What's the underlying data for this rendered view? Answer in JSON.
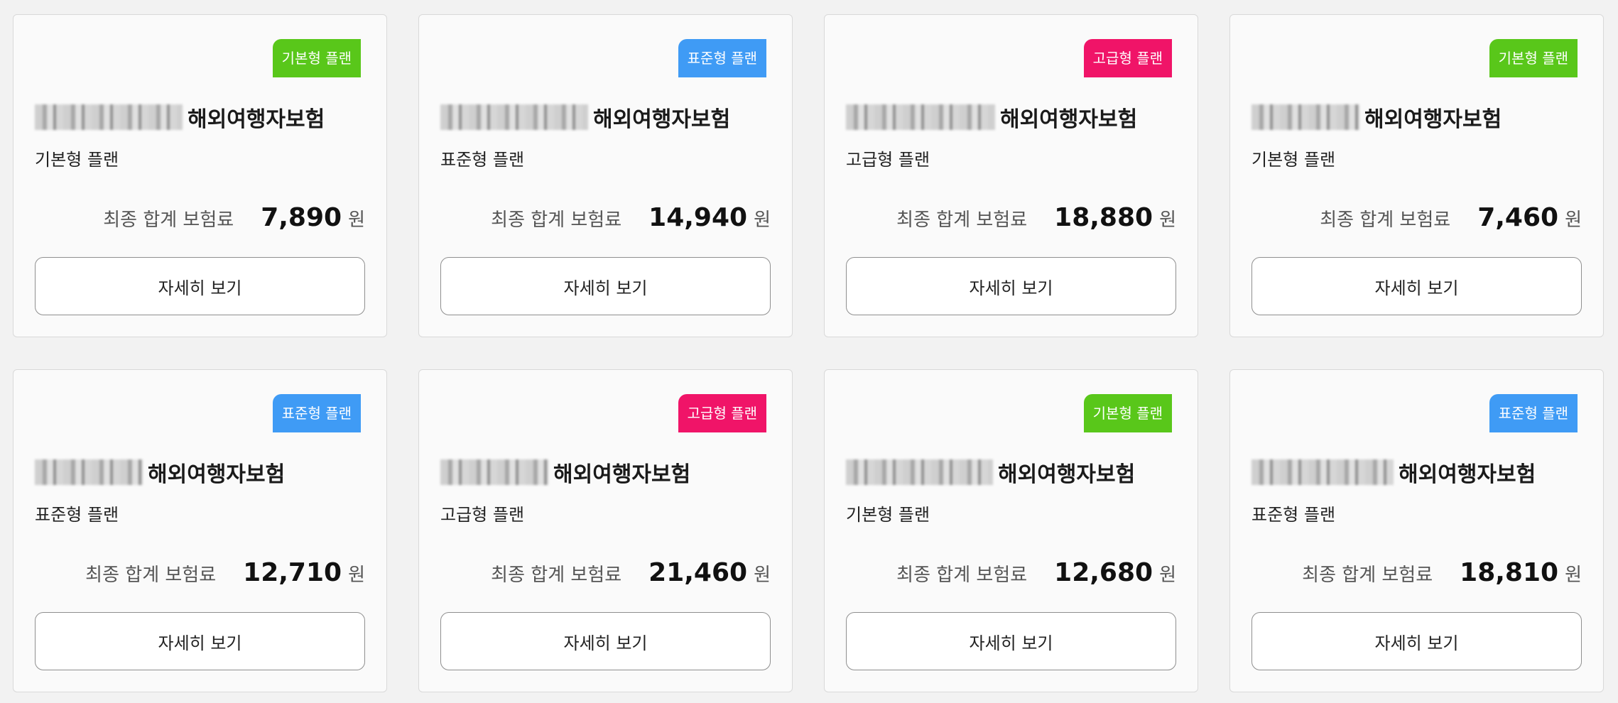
{
  "cards": [
    {
      "badge": "기본형 플랜",
      "badge_type": "basic",
      "product": "해외여행자보험",
      "plan": "기본형 플랜",
      "price_label": "최종 합계 보험료",
      "price": "7,890",
      "unit": "원",
      "button": "자세히 보기"
    },
    {
      "badge": "표준형 플랜",
      "badge_type": "standard",
      "product": "해외여행자보험",
      "plan": "표준형 플랜",
      "price_label": "최종 합계 보험료",
      "price": "14,940",
      "unit": "원",
      "button": "자세히 보기"
    },
    {
      "badge": "고급형 플랜",
      "badge_type": "premium",
      "product": "해외여행자보험",
      "plan": "고급형 플랜",
      "price_label": "최종 합계 보험료",
      "price": "18,880",
      "unit": "원",
      "button": "자세히 보기"
    },
    {
      "badge": "기본형 플랜",
      "badge_type": "basic",
      "product": "해외여행자보험",
      "plan": "기본형 플랜",
      "price_label": "최종 합계 보험료",
      "price": "7,460",
      "unit": "원",
      "button": "자세히 보기"
    },
    {
      "badge": "표준형 플랜",
      "badge_type": "standard",
      "product": "해외여행자보험",
      "plan": "표준형 플랜",
      "price_label": "최종 합계 보험료",
      "price": "12,710",
      "unit": "원",
      "button": "자세히 보기"
    },
    {
      "badge": "고급형 플랜",
      "badge_type": "premium",
      "product": "해외여행자보험",
      "plan": "고급형 플랜",
      "price_label": "최종 합계 보험료",
      "price": "21,460",
      "unit": "원",
      "button": "자세히 보기"
    },
    {
      "badge": "기본형 플랜",
      "badge_type": "basic",
      "product": "해외여행자보험",
      "plan": "기본형 플랜",
      "price_label": "최종 합계 보험료",
      "price": "12,680",
      "unit": "원",
      "button": "자세히 보기"
    },
    {
      "badge": "표준형 플랜",
      "badge_type": "standard",
      "product": "해외여행자보험",
      "plan": "표준형 플랜",
      "price_label": "최종 합계 보험료",
      "price": "18,810",
      "unit": "원",
      "button": "자세히 보기"
    }
  ],
  "colors": {
    "basic": "#59c71a",
    "standard": "#3f9bf5",
    "premium": "#f01468"
  }
}
